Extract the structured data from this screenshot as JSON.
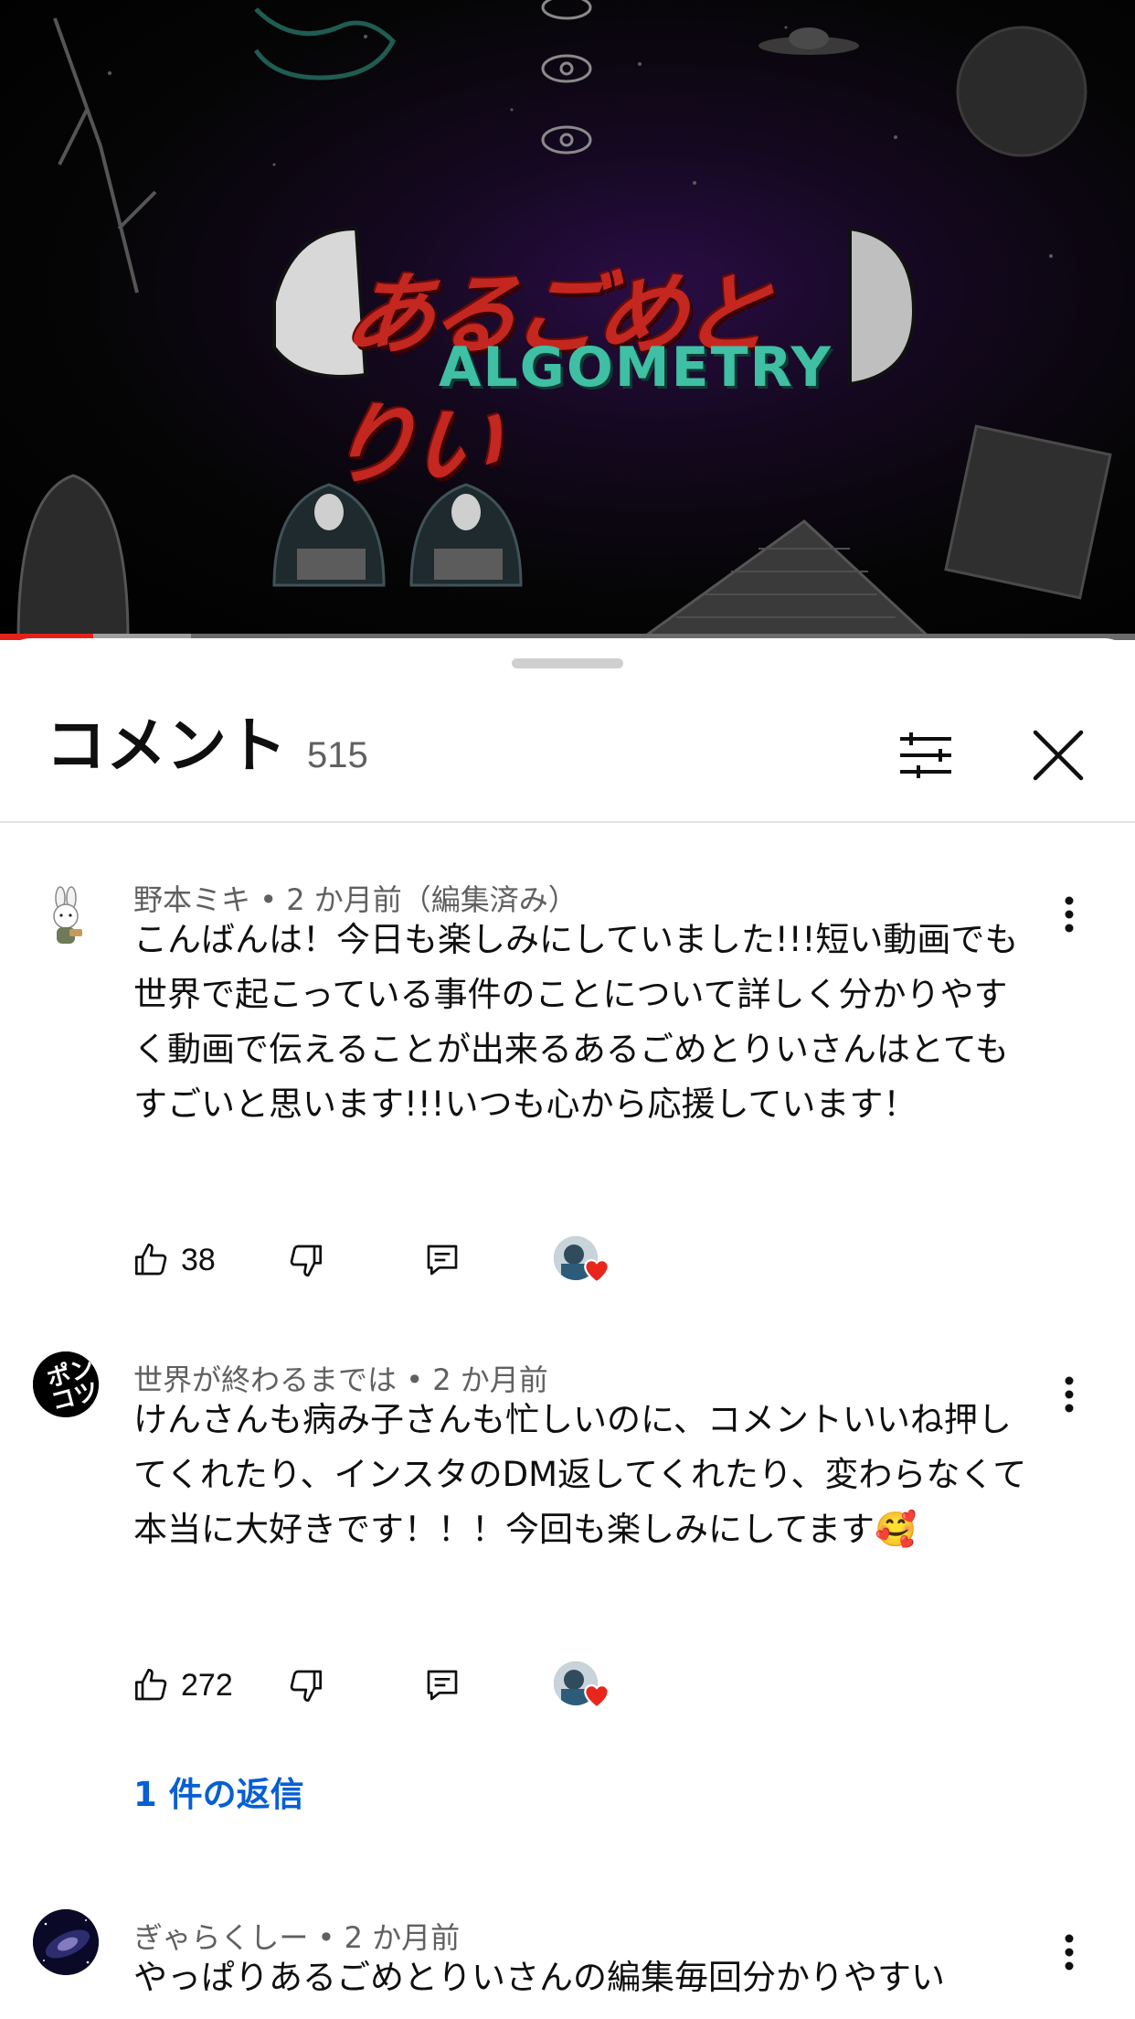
{
  "video": {
    "logo_jp": "あるごめとりい",
    "logo_en": "ALGOMETRY",
    "progress_played": 0.082,
    "progress_buffered": 0.168
  },
  "sheet": {
    "title": "コメント",
    "count": "515",
    "filter_icon": "sliders-icon",
    "close_icon": "close-icon"
  },
  "comments": [
    {
      "author": "野本ミキ",
      "time": "2 か月前（編集済み）",
      "text": "こんばんは！今日も楽しみにしていました!!!短い動画でも世界で起こっている事件のことについて詳しく分かりやすく動画で伝えることが出来るあるごめとりいさんはとてもすごいと思います!!!いつも心から応援しています！",
      "likes": "38",
      "creator_heart": true
    },
    {
      "author": "世界が終わるまでは",
      "time": "2 か月前",
      "text": "けんさんも病み子さんも忙しいのに、コメントいいね押してくれたり、インスタのDM返してくれたり、変わらなくて本当に大好きです！！！今回も楽しみにしてます🥰",
      "likes": "272",
      "creator_heart": true,
      "replies": "1 件の返信"
    },
    {
      "author": "ぎゃらくしー",
      "time": "2 か月前",
      "text": "やっぱりあるごめとりいさんの編集毎回分かりやすい"
    }
  ],
  "colors": {
    "accent_red": "#e62117",
    "link_blue": "#065fd4",
    "heart_red": "#e8261c",
    "secondary_text": "#606060"
  }
}
